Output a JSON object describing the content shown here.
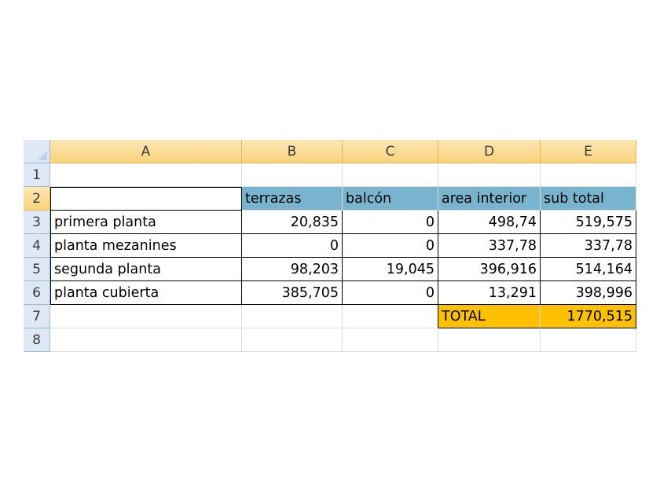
{
  "spreadsheet": {
    "column_headers": [
      "A",
      "B",
      "C",
      "D",
      "E"
    ],
    "row_headers": [
      "1",
      "2",
      "3",
      "4",
      "5",
      "6",
      "7",
      "8"
    ],
    "header_row": [
      "",
      "terrazas",
      "balcón",
      "area interior",
      "sub total"
    ],
    "rows": [
      [
        "primera planta",
        "20,835",
        "0",
        "498,74",
        "519,575"
      ],
      [
        "planta mezanines",
        "0",
        "0",
        "337,78",
        "337,78"
      ],
      [
        "segunda planta",
        "98,203",
        "19,045",
        "396,916",
        "514,164"
      ],
      [
        "planta cubierta",
        "385,705",
        "0",
        "13,291",
        "398,996"
      ]
    ],
    "total_label": "TOTAL",
    "total_value": "1770,515"
  },
  "colors": {
    "header_fill": "#78b4ce",
    "total_fill": "#ffc000",
    "column_header_fill": "#f9d27c",
    "row_header_fill": "#dfe8f5"
  }
}
